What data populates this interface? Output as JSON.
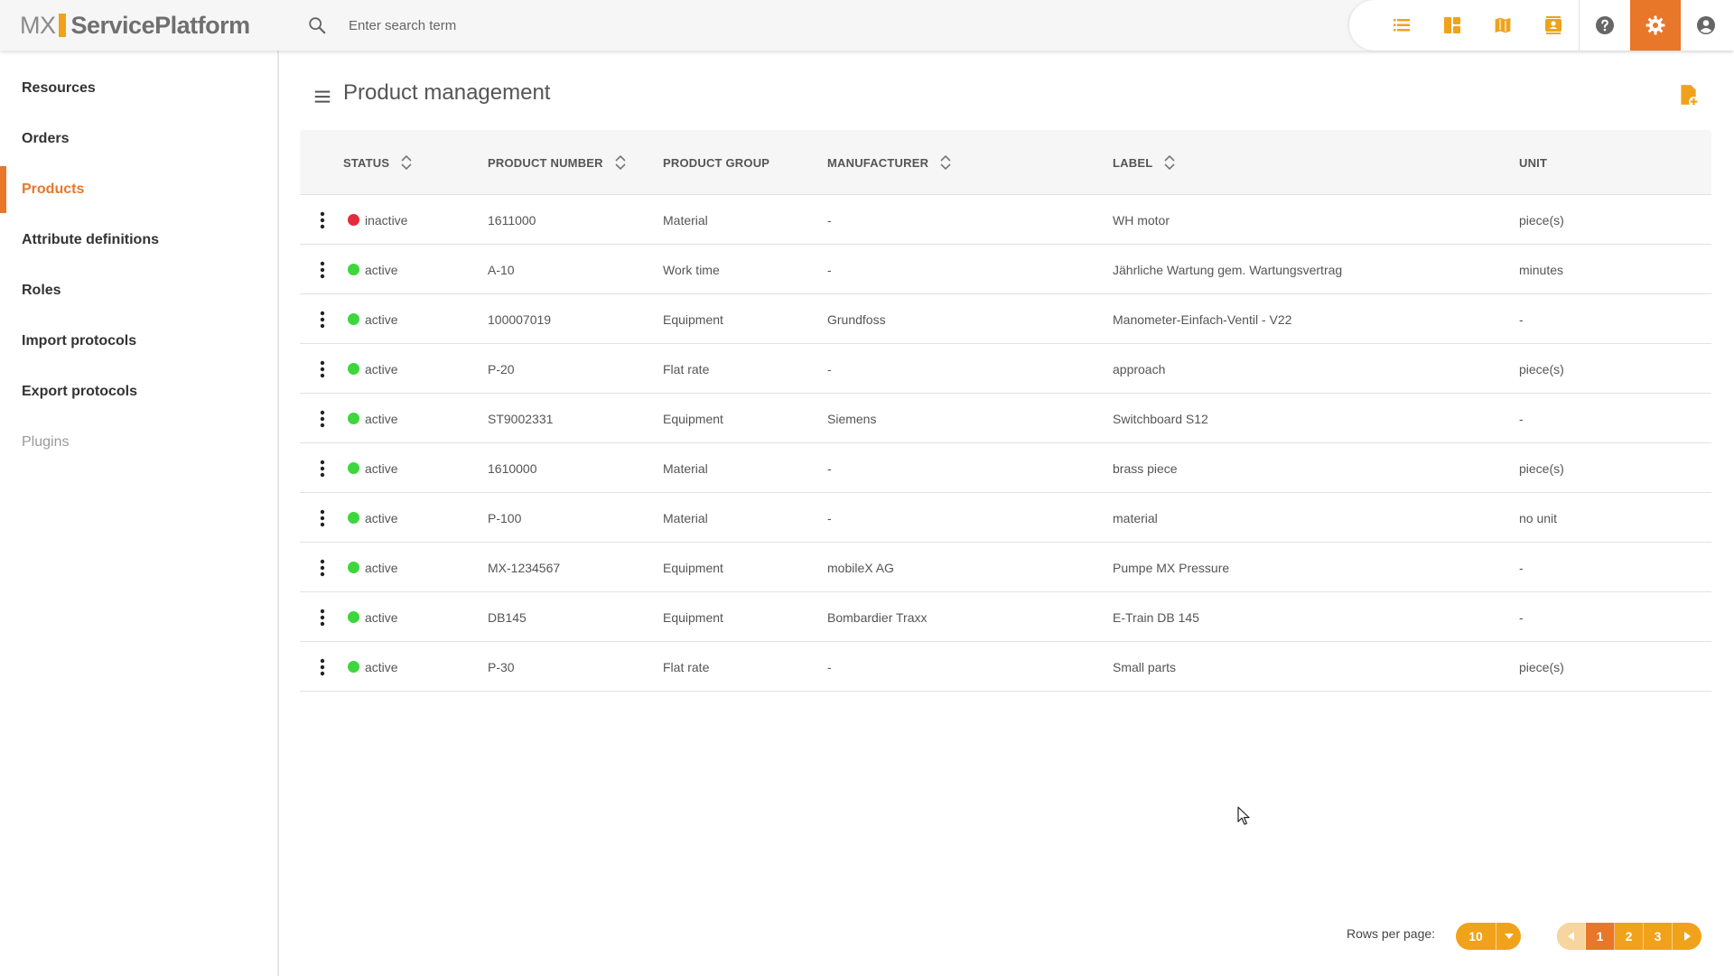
{
  "header": {
    "logo_mx": "MX",
    "logo_service": "ServicePlatform",
    "search_placeholder": "Enter search term",
    "accent": "#e8772a",
    "icon_color": "#f0a21a",
    "toolbar_icons": [
      "list-icon",
      "dashboard-icon",
      "map-icon",
      "contacts-icon",
      "help-icon",
      "settings-icon",
      "account-icon"
    ]
  },
  "sidebar": {
    "items": [
      {
        "label": "Resources"
      },
      {
        "label": "Orders"
      },
      {
        "label": "Products",
        "active": true
      },
      {
        "label": "Attribute definitions"
      },
      {
        "label": "Roles"
      },
      {
        "label": "Import protocols"
      },
      {
        "label": "Export protocols"
      },
      {
        "label": "Plugins",
        "disabled": true
      }
    ]
  },
  "main": {
    "title": "Product management",
    "columns": [
      "STATUS",
      "PRODUCT NUMBER",
      "PRODUCT GROUP",
      "MANUFACTURER",
      "LABEL",
      "UNIT"
    ],
    "rows": [
      {
        "status": "inactive",
        "status_color": "#e52b3a",
        "number": "1611000",
        "group": "Material",
        "manufacturer": "-",
        "label": "WH motor",
        "unit": "piece(s)"
      },
      {
        "status": "active",
        "status_color": "#3dd63d",
        "number": "A-10",
        "group": "Work time",
        "manufacturer": "-",
        "label": "Jährliche Wartung gem. Wartungsvertrag",
        "unit": "minutes"
      },
      {
        "status": "active",
        "status_color": "#3dd63d",
        "number": "100007019",
        "group": "Equipment",
        "manufacturer": "Grundfoss",
        "label": "Manometer-Einfach-Ventil - V22",
        "unit": "-"
      },
      {
        "status": "active",
        "status_color": "#3dd63d",
        "number": "P-20",
        "group": "Flat rate",
        "manufacturer": "-",
        "label": "approach",
        "unit": "piece(s)"
      },
      {
        "status": "active",
        "status_color": "#3dd63d",
        "number": "ST9002331",
        "group": "Equipment",
        "manufacturer": "Siemens",
        "label": "Switchboard S12",
        "unit": "-"
      },
      {
        "status": "active",
        "status_color": "#3dd63d",
        "number": "1610000",
        "group": "Material",
        "manufacturer": "-",
        "label": "brass piece",
        "unit": "piece(s)"
      },
      {
        "status": "active",
        "status_color": "#3dd63d",
        "number": "P-100",
        "group": "Material",
        "manufacturer": "-",
        "label": "material",
        "unit": "no unit"
      },
      {
        "status": "active",
        "status_color": "#3dd63d",
        "number": "MX-1234567",
        "group": "Equipment",
        "manufacturer": "mobileX AG",
        "label": "Pumpe MX Pressure",
        "unit": "-"
      },
      {
        "status": "active",
        "status_color": "#3dd63d",
        "number": "DB145",
        "group": "Equipment",
        "manufacturer": "Bombardier Traxx",
        "label": "E-Train DB 145",
        "unit": "-"
      },
      {
        "status": "active",
        "status_color": "#3dd63d",
        "number": "P-30",
        "group": "Flat rate",
        "manufacturer": "-",
        "label": "Small parts",
        "unit": "piece(s)"
      }
    ]
  },
  "pagination": {
    "rows_per_page_label": "Rows per page:",
    "rows_per_page": "10",
    "pages": [
      "1",
      "2",
      "3"
    ],
    "current_page": "1"
  }
}
